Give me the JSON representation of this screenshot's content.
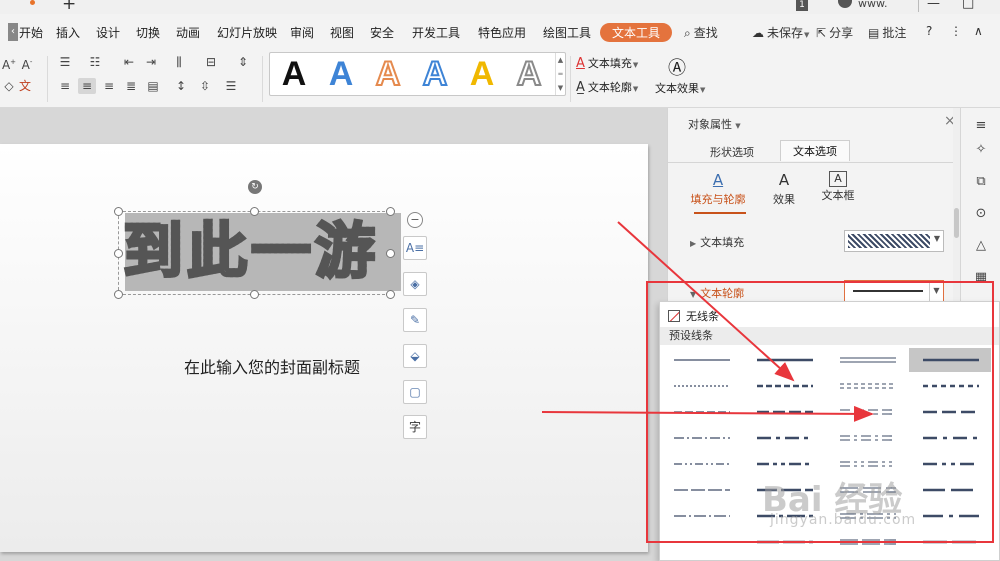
{
  "titlebar": {
    "plus": "+",
    "badge": "1",
    "user": "www.",
    "minimize": "—",
    "maximize": "□"
  },
  "menu": {
    "back_glyph": "‹",
    "start": "开始",
    "items": [
      "插入",
      "设计",
      "切换",
      "动画",
      "幻灯片放映",
      "审阅",
      "视图",
      "安全",
      "开发工具",
      "特色应用",
      "绘图工具"
    ],
    "active": "文本工具",
    "search": "查找",
    "unsaved": "未保存",
    "share": "分享",
    "annotate": "批注",
    "help": "?",
    "more": "⋮",
    "collapse": "∧"
  },
  "ribbon": {
    "text_fill": "文本填充",
    "text_outline": "文本轮廓",
    "text_effect": "文本效果",
    "style_glyph": "A",
    "style_colors": [
      "#111111",
      "#3e84d6",
      "#e58a4e",
      "#3e84d6",
      "#f0b800",
      "#8a8a8a"
    ]
  },
  "slide": {
    "title": "到此一游",
    "subtitle": "在此输入您的封面副标题",
    "tools": [
      "text-format",
      "layers",
      "brush",
      "fill",
      "outline",
      "char"
    ]
  },
  "panel": {
    "title": "对象属性",
    "close": "×",
    "tabs": [
      "形状选项",
      "文本选项"
    ],
    "active_tab": "文本选项",
    "subtabs": [
      {
        "label": "填充与轮廓",
        "icon": "A"
      },
      {
        "label": "效果",
        "icon": "A"
      },
      {
        "label": "文本框",
        "icon": "A"
      }
    ],
    "fill_label": "文本填充",
    "outline_label": "文本轮廓"
  },
  "dropdown": {
    "none_label": "无线条",
    "preset_label": "预设线条"
  },
  "watermark": {
    "main": "Bai 经验",
    "sub": "jingyan.baidu.com"
  },
  "colors": {
    "accent": "#e4733d",
    "highlight": "#e8363c",
    "line": "#3d4b66"
  }
}
